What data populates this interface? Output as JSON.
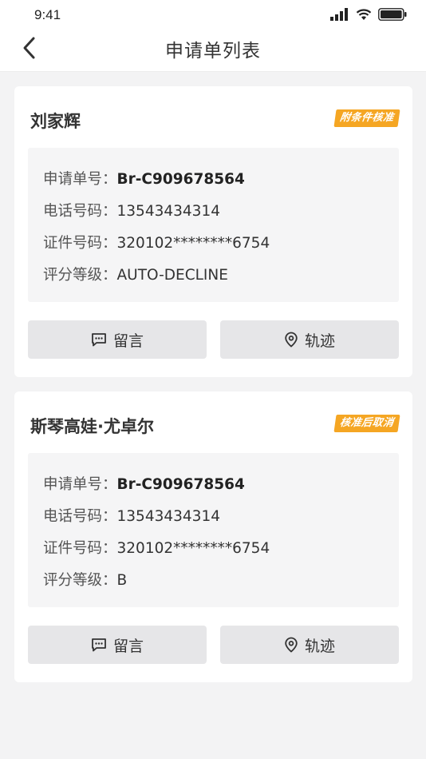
{
  "status_bar": {
    "time": "9:41"
  },
  "nav": {
    "title": "申请单列表"
  },
  "applications": [
    {
      "name": "刘家辉",
      "badge": "附条件核准",
      "fields": [
        {
          "label": "申请单号：",
          "value": "Br-C909678564"
        },
        {
          "label": "电话号码：",
          "value": "13543434314"
        },
        {
          "label": "证件号码：",
          "value": "320102********6754"
        },
        {
          "label": "评分等级：",
          "value": "AUTO-DECLINE"
        }
      ],
      "actions": {
        "message": "留言",
        "track": "轨迹"
      }
    },
    {
      "name": "斯琴高娃·尤卓尔",
      "badge": "核准后取消",
      "fields": [
        {
          "label": "申请单号：",
          "value": "Br-C909678564"
        },
        {
          "label": "电话号码：",
          "value": "13543434314"
        },
        {
          "label": "证件号码：",
          "value": "320102********6754"
        },
        {
          "label": "评分等级：",
          "value": "B"
        }
      ],
      "actions": {
        "message": "留言",
        "track": "轨迹"
      }
    }
  ],
  "colors": {
    "badge": "#f5a623",
    "background": "#f3f3f4",
    "info_box": "#f5f5f6",
    "button": "#e6e6e8"
  },
  "icons": {
    "back": "chevron-left-icon",
    "message": "message-icon",
    "track": "location-pin-icon"
  }
}
